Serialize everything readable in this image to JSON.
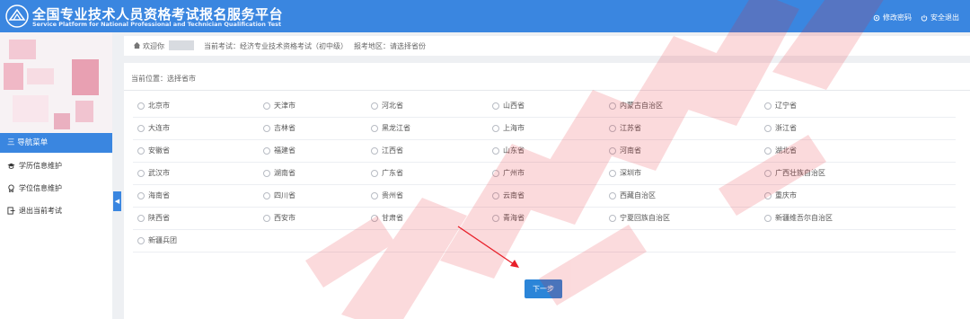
{
  "header": {
    "title_zh": "全国专业技术人员资格考试报名服务平台",
    "title_en": "Service Platform for National Professional and Technician Qualification Test",
    "links": [
      "修改密码",
      "安全退出"
    ]
  },
  "sidebar": {
    "nav_head": "三 导航菜单",
    "items": [
      "学历信息维护",
      "学位信息维护",
      "退出当前考试"
    ],
    "collapse": "◀"
  },
  "infobar": {
    "welcome": "欢迎你",
    "exam": "当前考试：经济专业技术资格考试（初中级）",
    "area": "报考地区：请选择省份"
  },
  "panel": {
    "location": "当前位置：选择省市",
    "rows": [
      [
        "北京市",
        "天津市",
        "河北省",
        "山西省",
        "内蒙古自治区",
        "辽宁省"
      ],
      [
        "大连市",
        "吉林省",
        "黑龙江省",
        "上海市",
        "江苏省",
        "浙江省"
      ],
      [
        "安徽省",
        "福建省",
        "江西省",
        "山东省",
        "河南省",
        "湖北省"
      ],
      [
        "武汉市",
        "湖南省",
        "广东省",
        "广州市",
        "深圳市",
        "广西壮族自治区"
      ],
      [
        "海南省",
        "四川省",
        "贵州省",
        "云南省",
        "西藏自治区",
        "重庆市"
      ],
      [
        "陕西省",
        "西安市",
        "甘肃省",
        "青海省",
        "宁夏回族自治区",
        "新疆维吾尔自治区"
      ],
      [
        "新疆兵团"
      ]
    ],
    "next_button": "下一步"
  },
  "colors": {
    "primary": "#3a86e0",
    "button": "#2b85d8",
    "watermark": "#e8202a"
  }
}
